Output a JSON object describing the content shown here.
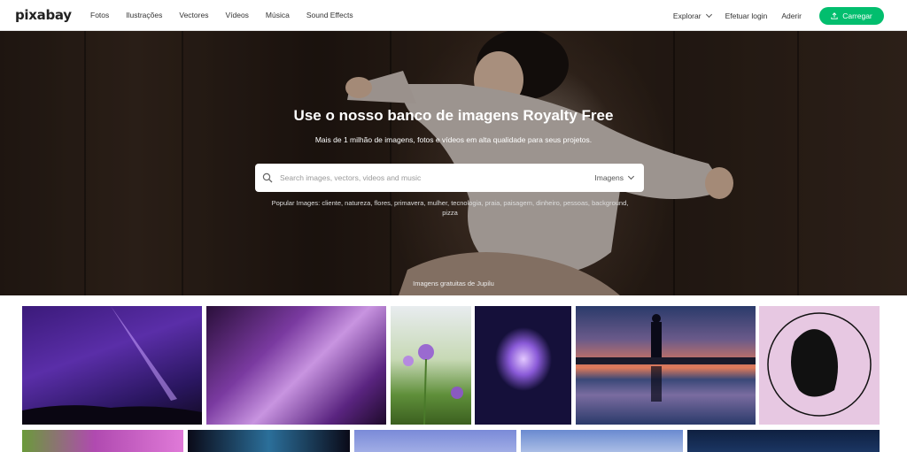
{
  "nav": {
    "logo": "pixabay",
    "links": [
      "Fotos",
      "Ilustrações",
      "Vectores",
      "Vídeos",
      "Música",
      "Sound Effects"
    ],
    "explore_label": "Explorar",
    "login_label": "Efetuar login",
    "join_label": "Aderir",
    "upload_label": "Carregar",
    "upload_color": "#02be6e"
  },
  "hero": {
    "title": "Use o nosso banco de imagens Royalty Free",
    "subtitle": "Mais de 1 milhão de imagens, fotos e vídeos em alta qualidade para seus projetos.",
    "search_placeholder": "Search images, vectors, videos and music",
    "search_type": "Imagens",
    "popular_images": "Popular Images: cliente, natureza, flores, primavera, mulher, tecnologia, praia, paisagem, dinheiro, pessoas, background, pizza",
    "credit": "Imagens gratuitas de Jupilu"
  },
  "gallery": {
    "icons": [
      "search-icon",
      "upload-icon",
      "chevron-down-icon"
    ]
  }
}
